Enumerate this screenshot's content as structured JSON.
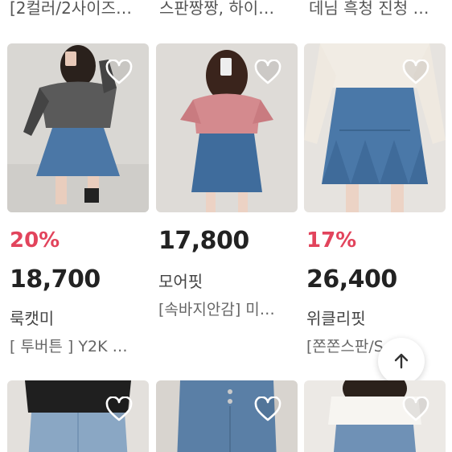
{
  "top_row": [
    "[2컬러/2사이즈…",
    "스판짱짱, 하이…",
    "데님 흑청 진청 …"
  ],
  "products": [
    {
      "discount": "20%",
      "price": "18,700",
      "shop": "룩캣미",
      "title": "[ 투버튼 ] Y2K …",
      "image_icon": "photo-off-shoulder-denim-skirt",
      "heart_icon": "heart-outline-icon"
    },
    {
      "discount": "",
      "price": "17,800",
      "shop": "모어핏",
      "title": "[속바지안감] 미…",
      "image_icon": "photo-pink-cardigan-denim-skirt",
      "heart_icon": "heart-outline-icon"
    },
    {
      "discount": "17%",
      "price": "26,400",
      "shop": "위클리핏",
      "title": "[쫀쫀스판/S…",
      "image_icon": "photo-denim-flare-skirt",
      "heart_icon": "heart-outline-icon"
    }
  ],
  "bottom_row": [
    {
      "image_icon": "photo-denim-jeans-black-top",
      "heart_icon": "heart-outline-icon"
    },
    {
      "image_icon": "photo-denim-jeans-waist",
      "heart_icon": "heart-outline-icon"
    },
    {
      "image_icon": "photo-denim-jeans-white-top",
      "heart_icon": "heart-outline-icon"
    }
  ],
  "scroll_top_icon": "arrow-up-icon",
  "colors": {
    "discount": "#e2445c",
    "price": "#222222",
    "denim": "#4a78a8"
  }
}
